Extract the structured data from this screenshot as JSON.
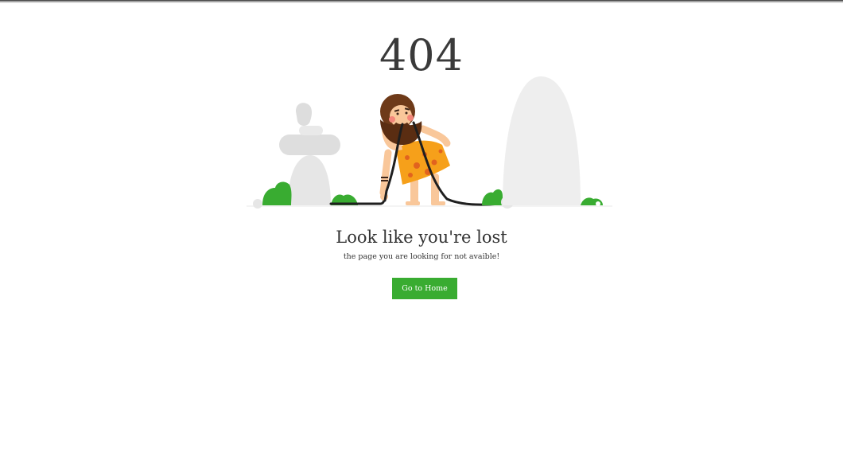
{
  "error_page": {
    "code": "404",
    "headline": "Look like you're lost",
    "subtext": "the page you are looking for not avaible!",
    "button_label": "Go to Home"
  },
  "colors": {
    "accent": "#39ac31",
    "text": "#333333",
    "rock": "#eeeeee",
    "bush": "#39ac31",
    "tunic": "#f6a01a"
  },
  "illustration": {
    "icon": "caveman-holding-cable-illustration"
  }
}
